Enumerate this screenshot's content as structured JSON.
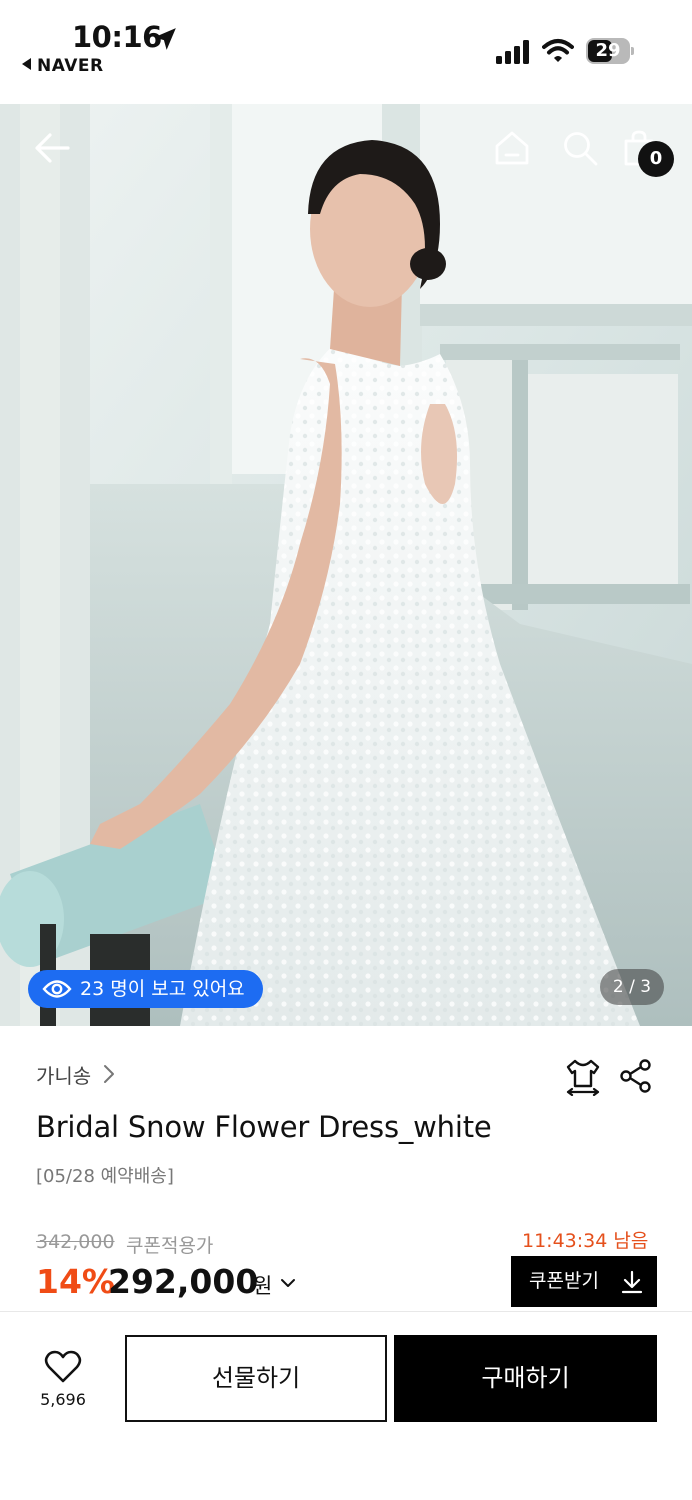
{
  "status_bar": {
    "time": "10:16",
    "back_app": "NAVER",
    "battery": "29"
  },
  "hero": {
    "cart_count": "0",
    "viewers_text": "23 명이 보고 있어요",
    "pager": "2 / 3"
  },
  "product": {
    "brand": "가니송",
    "title": "Bridal Snow Flower Dress_white",
    "delivery": "[05/28 예약배송]",
    "original_price": "342,000",
    "coupon_price_label": "쿠폰적용가",
    "discount": "14%",
    "price": "292,000",
    "currency": "원",
    "countdown": "11:43:34 남음",
    "coupon_button": "쿠폰받기"
  },
  "bottom_bar": {
    "like_count": "5,696",
    "gift_button": "선물하기",
    "buy_button": "구매하기"
  },
  "colors": {
    "accent_discount": "#f04c16",
    "viewers_badge": "#1d6cf2",
    "primary_button": "#000000"
  },
  "icons": [
    "location-arrow-icon",
    "signal-icon",
    "wifi-icon",
    "battery-icon",
    "back-arrow-icon",
    "home-icon",
    "search-icon",
    "cart-icon",
    "eye-icon",
    "chevron-right-icon",
    "size-fit-icon",
    "share-icon",
    "chevron-down-icon",
    "download-icon",
    "heart-icon"
  ]
}
